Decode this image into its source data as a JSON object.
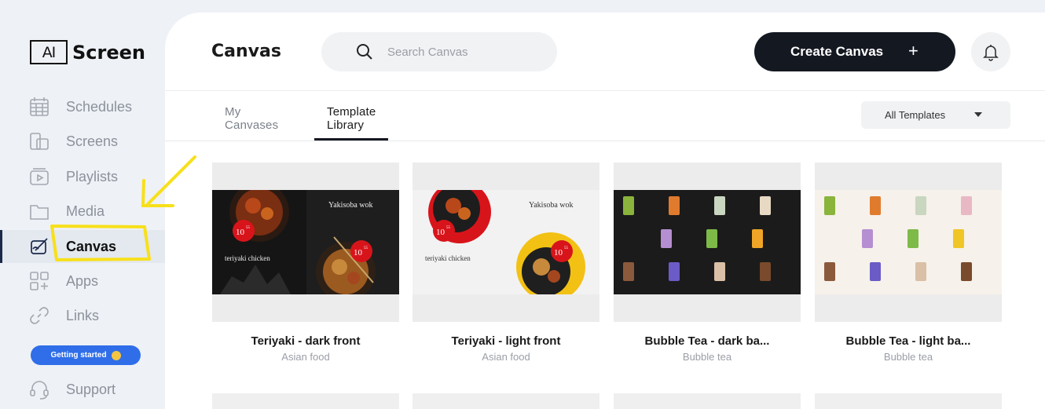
{
  "app": {
    "logo_mark": "AI",
    "logo_text": "Screen"
  },
  "sidebar": {
    "items": [
      {
        "label": "Schedules",
        "icon": "calendar-icon"
      },
      {
        "label": "Screens",
        "icon": "screens-icon"
      },
      {
        "label": "Playlists",
        "icon": "playlist-icon"
      },
      {
        "label": "Media",
        "icon": "folder-icon"
      },
      {
        "label": "Canvas",
        "icon": "canvas-icon",
        "active": true
      },
      {
        "label": "Apps",
        "icon": "apps-icon"
      },
      {
        "label": "Links",
        "icon": "link-icon"
      }
    ],
    "getting_started": "Getting started",
    "support": "Support"
  },
  "header": {
    "title": "Canvas",
    "search_placeholder": "Search Canvas",
    "create_label": "Create Canvas",
    "create_icon": "+"
  },
  "tabs": [
    {
      "label": "My Canvases"
    },
    {
      "label": "Template Library",
      "active": true
    }
  ],
  "filter": {
    "selected": "All Templates"
  },
  "templates": [
    {
      "title": "Teriyaki - dark front",
      "category": "Asian food",
      "theme": "dark",
      "heading": "Yakisoba wok",
      "subheading": "teriyaki chicken",
      "price": "10",
      "cents": "55"
    },
    {
      "title": "Teriyaki - light front",
      "category": "Asian food",
      "theme": "light",
      "heading": "Yakisoba wok",
      "subheading": "teriyaki chicken",
      "price": "10",
      "cents": "55"
    },
    {
      "title": "Bubble Tea - dark ba...",
      "category": "Bubble tea",
      "theme": "dark"
    },
    {
      "title": "Bubble Tea - light ba...",
      "category": "Bubble tea",
      "theme": "light"
    }
  ],
  "colors": {
    "accent": "#2f6ee8",
    "primary_button": "#141821",
    "annotation": "#f7e01a",
    "price_badge": "#d8141b"
  }
}
